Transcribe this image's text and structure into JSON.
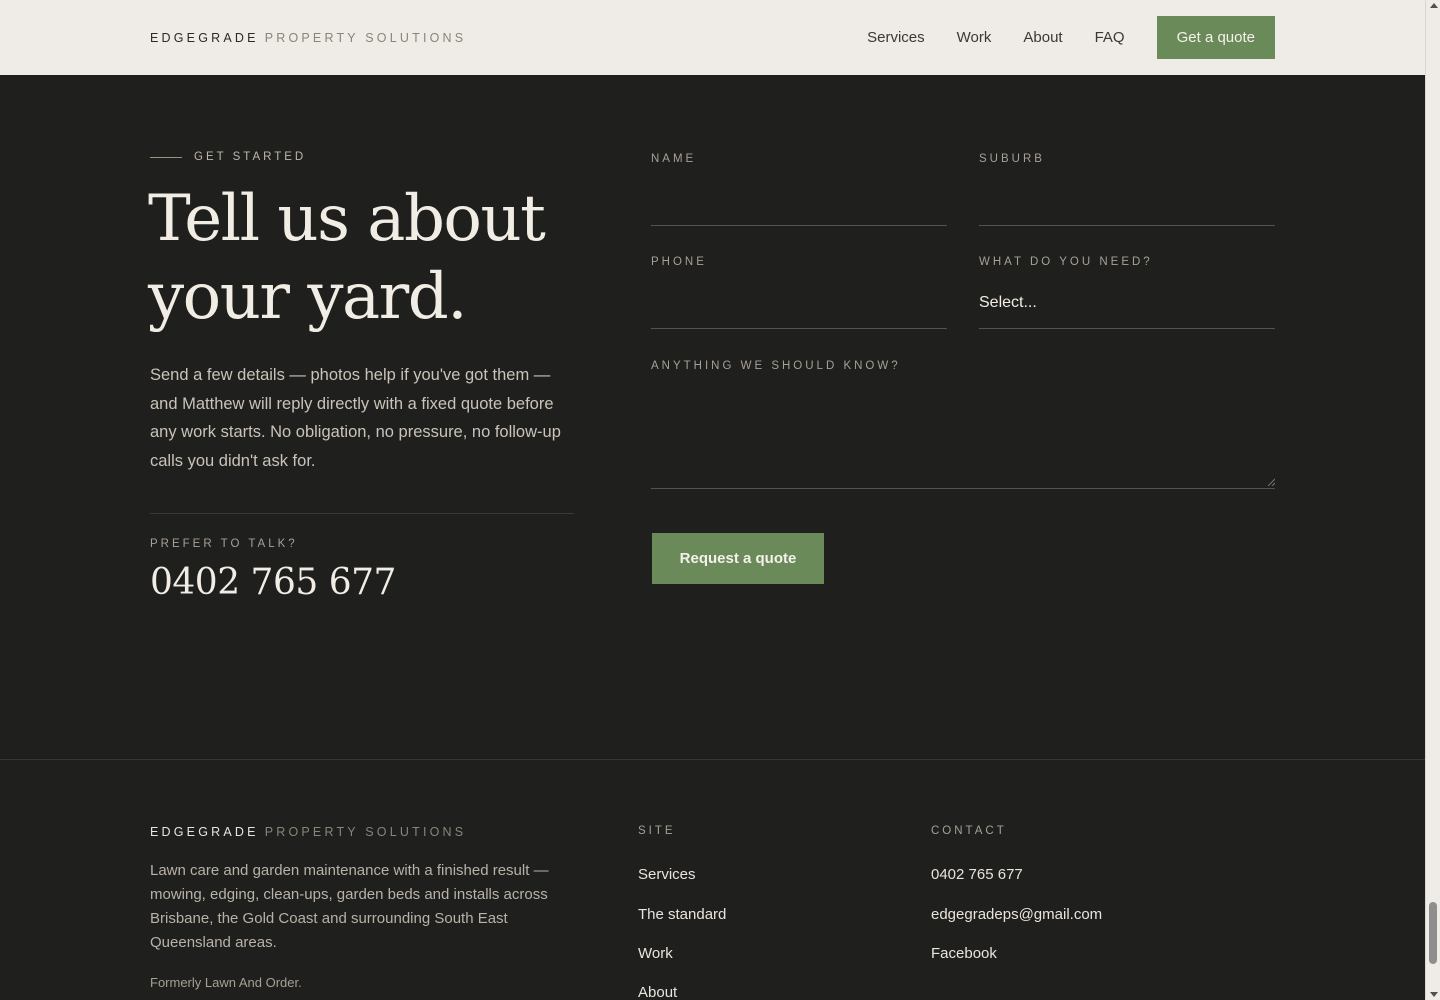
{
  "header": {
    "logo_brand": "EDGEGRADE",
    "logo_sub": "PROPERTY SOLUTIONS",
    "nav": [
      "Services",
      "Work",
      "About",
      "FAQ"
    ],
    "cta": "Get a quote"
  },
  "intro": {
    "eyebrow": "GET STARTED",
    "headline": "Tell us about your yard.",
    "body": "Send a few details — photos help if you've got them — and Matthew will reply directly with a fixed quote before any work starts. No obligation, no pressure, no follow-up calls you didn't ask for.",
    "talk_label": "PREFER TO TALK?",
    "phone": "0402 765 677"
  },
  "form": {
    "name_label": "NAME",
    "suburb_label": "SUBURB",
    "phone_label": "PHONE",
    "need_label": "WHAT DO YOU NEED?",
    "need_value": "Select...",
    "notes_label": "ANYTHING WE SHOULD KNOW?",
    "submit": "Request a quote"
  },
  "footer": {
    "logo_brand": "EDGEGRADE",
    "logo_sub": "PROPERTY SOLUTIONS",
    "about": "Lawn care and garden maintenance with a finished result — mowing, edging, clean-ups, garden beds and installs across Brisbane, the Gold Coast and surrounding South East Queensland areas.",
    "formerly": "Formerly Lawn And Order.",
    "site_heading": "SITE",
    "site_links": [
      "Services",
      "The standard",
      "Work",
      "About"
    ],
    "contact_heading": "CONTACT",
    "contact_links": [
      "0402 765 677",
      "edgegradeps@gmail.com",
      "Facebook"
    ]
  },
  "colors": {
    "accent": "#6b8a5a",
    "background": "#1f1f1e",
    "header": "#efebe6"
  }
}
